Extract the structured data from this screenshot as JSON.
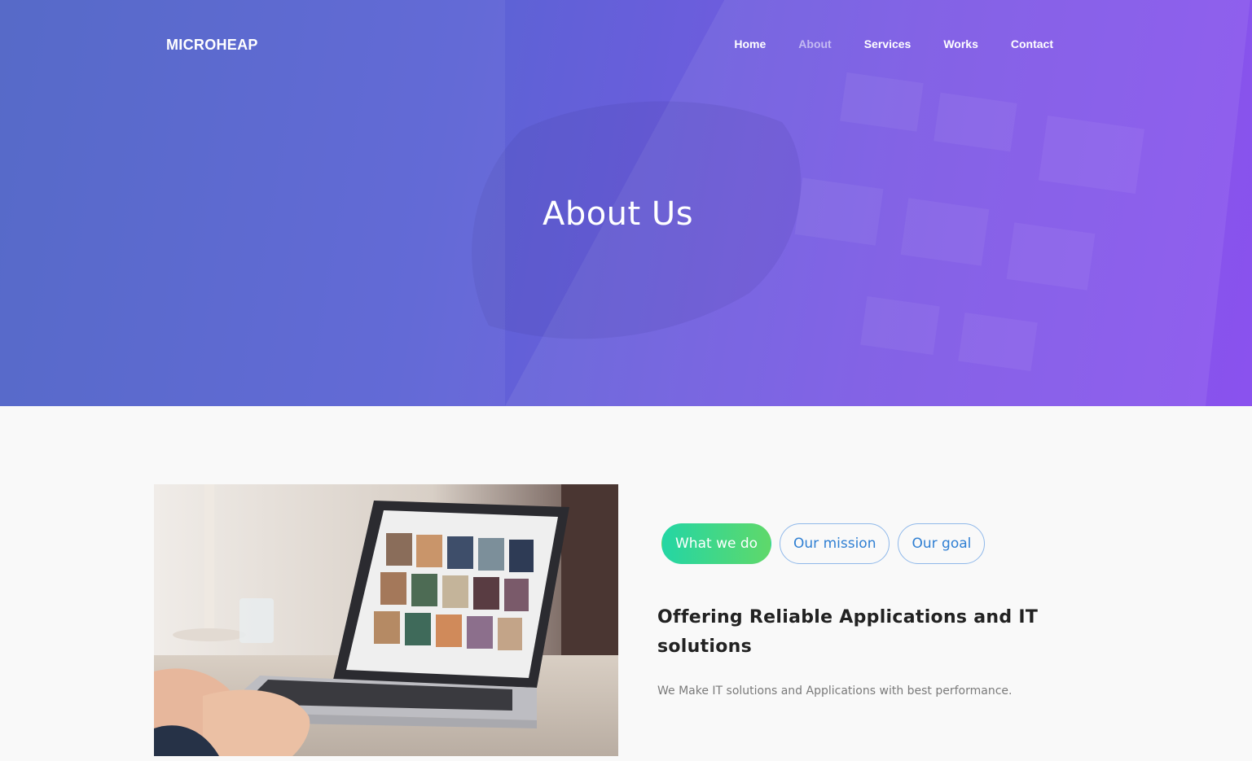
{
  "header": {
    "brand": "MICROHEAP",
    "nav": [
      {
        "label": "Home"
      },
      {
        "label": "About"
      },
      {
        "label": "Services"
      },
      {
        "label": "Works"
      },
      {
        "label": "Contact"
      }
    ],
    "active_nav": "About"
  },
  "hero": {
    "title": "About Us",
    "gradient": [
      "#4e62c6",
      "#8a52ee"
    ]
  },
  "about": {
    "tabs": [
      {
        "label": "What we do",
        "active": true
      },
      {
        "label": "Our mission",
        "active": false
      },
      {
        "label": "Our goal",
        "active": false
      }
    ],
    "heading": "Offering Reliable Applications and IT solutions",
    "description": "We Make IT solutions and Applications with best performance.",
    "image_icon": "laptop-photo"
  },
  "colors": {
    "tab_active_start": "#24d6a4",
    "tab_active_end": "#5fd86a",
    "tab_outline": "#2f7fd3"
  }
}
